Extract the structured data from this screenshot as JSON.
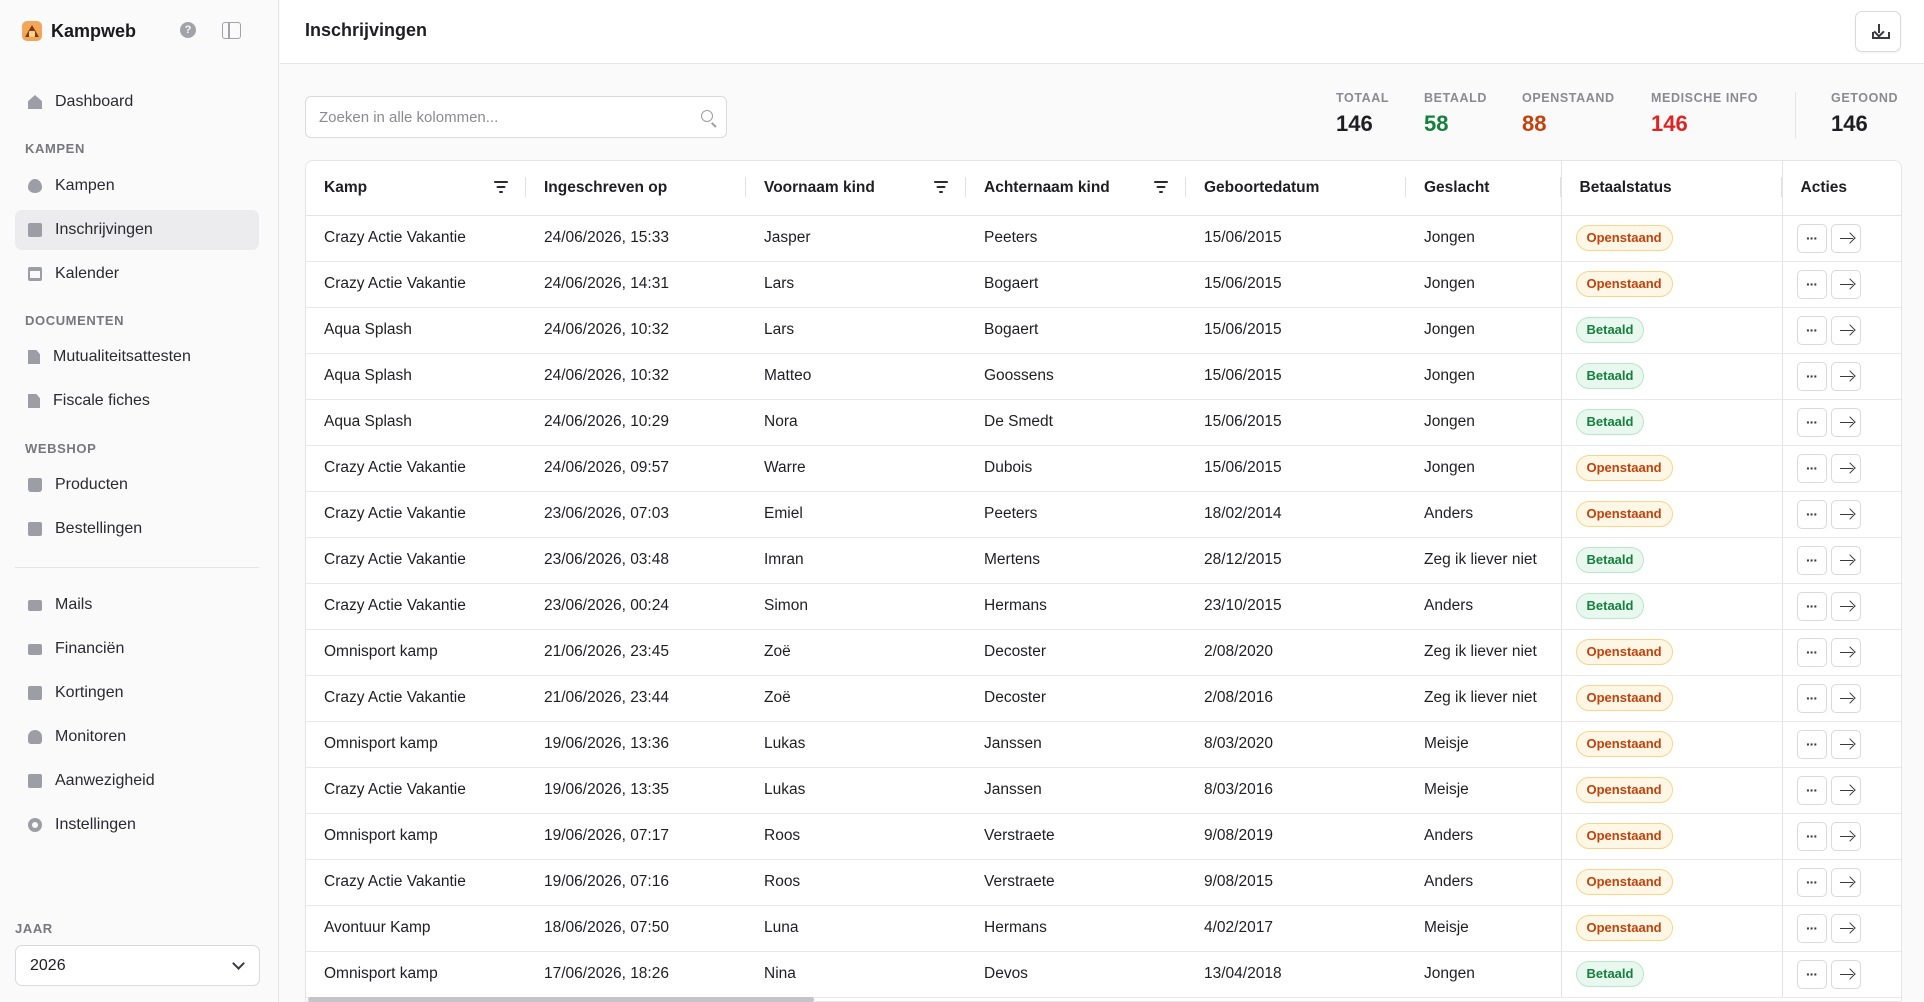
{
  "app": {
    "name": "Kampweb",
    "page_title": "Inschrijvingen"
  },
  "sidebar": {
    "top_item": {
      "label": "Dashboard",
      "icon": "home-icon"
    },
    "sections": [
      {
        "label": "KAMPEN",
        "items": [
          {
            "label": "Kampen",
            "icon": "flame-icon"
          },
          {
            "label": "Inschrijvingen",
            "icon": "clipboard-icon",
            "active": true
          },
          {
            "label": "Kalender",
            "icon": "calendar-icon"
          }
        ]
      },
      {
        "label": "DOCUMENTEN",
        "items": [
          {
            "label": "Mutualiteitsattesten",
            "icon": "document-icon"
          },
          {
            "label": "Fiscale fiches",
            "icon": "document-icon"
          }
        ]
      },
      {
        "label": "WEBSHOP",
        "items": [
          {
            "label": "Producten",
            "icon": "shopping-bag-icon"
          },
          {
            "label": "Bestellingen",
            "icon": "clipboard-icon"
          }
        ]
      }
    ],
    "bottom_items": [
      {
        "label": "Mails",
        "icon": "mail-icon"
      },
      {
        "label": "Financiën",
        "icon": "money-icon"
      },
      {
        "label": "Kortingen",
        "icon": "ticket-icon"
      },
      {
        "label": "Monitoren",
        "icon": "users-icon"
      },
      {
        "label": "Aanwezigheid",
        "icon": "clipboard-icon"
      },
      {
        "label": "Instellingen",
        "icon": "gear-icon"
      }
    ],
    "year_label": "JAAR",
    "year_value": "2026"
  },
  "search": {
    "placeholder": "Zoeken in alle kolommen...",
    "value": ""
  },
  "stats": [
    {
      "label": "TOTAAL",
      "value": "146",
      "color": "#1f1f23"
    },
    {
      "label": "BETAALD",
      "value": "58",
      "color": "#15803d"
    },
    {
      "label": "OPENSTAAND",
      "value": "88",
      "color": "#c2410c"
    },
    {
      "label": "MEDISCHE INFO",
      "value": "146",
      "color": "#dc2626"
    },
    {
      "label": "GETOOND",
      "value": "146",
      "color": "#1f1f23"
    }
  ],
  "table": {
    "columns": [
      "Kamp",
      "Ingeschreven op",
      "Voornaam kind",
      "Achternaam kind",
      "Geboortedatum",
      "Geslacht",
      "Betaalstatus",
      "Acties"
    ],
    "filterable": [
      true,
      false,
      true,
      true,
      false,
      false,
      false,
      false
    ],
    "rows": [
      [
        "Crazy Actie Vakantie",
        "24/06/2026, 15:33",
        "Jasper",
        "Peeters",
        "15/06/2015",
        "Jongen",
        "Openstaand"
      ],
      [
        "Crazy Actie Vakantie",
        "24/06/2026, 14:31",
        "Lars",
        "Bogaert",
        "15/06/2015",
        "Jongen",
        "Openstaand"
      ],
      [
        "Aqua Splash",
        "24/06/2026, 10:32",
        "Lars",
        "Bogaert",
        "15/06/2015",
        "Jongen",
        "Betaald"
      ],
      [
        "Aqua Splash",
        "24/06/2026, 10:32",
        "Matteo",
        "Goossens",
        "15/06/2015",
        "Jongen",
        "Betaald"
      ],
      [
        "Aqua Splash",
        "24/06/2026, 10:29",
        "Nora",
        "De Smedt",
        "15/06/2015",
        "Jongen",
        "Betaald"
      ],
      [
        "Crazy Actie Vakantie",
        "24/06/2026, 09:57",
        "Warre",
        "Dubois",
        "15/06/2015",
        "Jongen",
        "Openstaand"
      ],
      [
        "Crazy Actie Vakantie",
        "23/06/2026, 07:03",
        "Emiel",
        "Peeters",
        "18/02/2014",
        "Anders",
        "Openstaand"
      ],
      [
        "Crazy Actie Vakantie",
        "23/06/2026, 03:48",
        "Imran",
        "Mertens",
        "28/12/2015",
        "Zeg ik liever niet",
        "Betaald"
      ],
      [
        "Crazy Actie Vakantie",
        "23/06/2026, 00:24",
        "Simon",
        "Hermans",
        "23/10/2015",
        "Anders",
        "Betaald"
      ],
      [
        "Omnisport kamp",
        "21/06/2026, 23:45",
        "Zoë",
        "Decoster",
        "2/08/2020",
        "Zeg ik liever niet",
        "Openstaand"
      ],
      [
        "Crazy Actie Vakantie",
        "21/06/2026, 23:44",
        "Zoë",
        "Decoster",
        "2/08/2016",
        "Zeg ik liever niet",
        "Openstaand"
      ],
      [
        "Omnisport kamp",
        "19/06/2026, 13:36",
        "Lukas",
        "Janssen",
        "8/03/2020",
        "Meisje",
        "Openstaand"
      ],
      [
        "Crazy Actie Vakantie",
        "19/06/2026, 13:35",
        "Lukas",
        "Janssen",
        "8/03/2016",
        "Meisje",
        "Openstaand"
      ],
      [
        "Omnisport kamp",
        "19/06/2026, 07:17",
        "Roos",
        "Verstraete",
        "9/08/2019",
        "Anders",
        "Openstaand"
      ],
      [
        "Crazy Actie Vakantie",
        "19/06/2026, 07:16",
        "Roos",
        "Verstraete",
        "9/08/2015",
        "Anders",
        "Openstaand"
      ],
      [
        "Avontuur Kamp",
        "18/06/2026, 07:50",
        "Luna",
        "Hermans",
        "4/02/2017",
        "Meisje",
        "Openstaand"
      ],
      [
        "Omnisport kamp",
        "17/06/2026, 18:26",
        "Nina",
        "Devos",
        "13/04/2018",
        "Jongen",
        "Betaald"
      ]
    ]
  }
}
